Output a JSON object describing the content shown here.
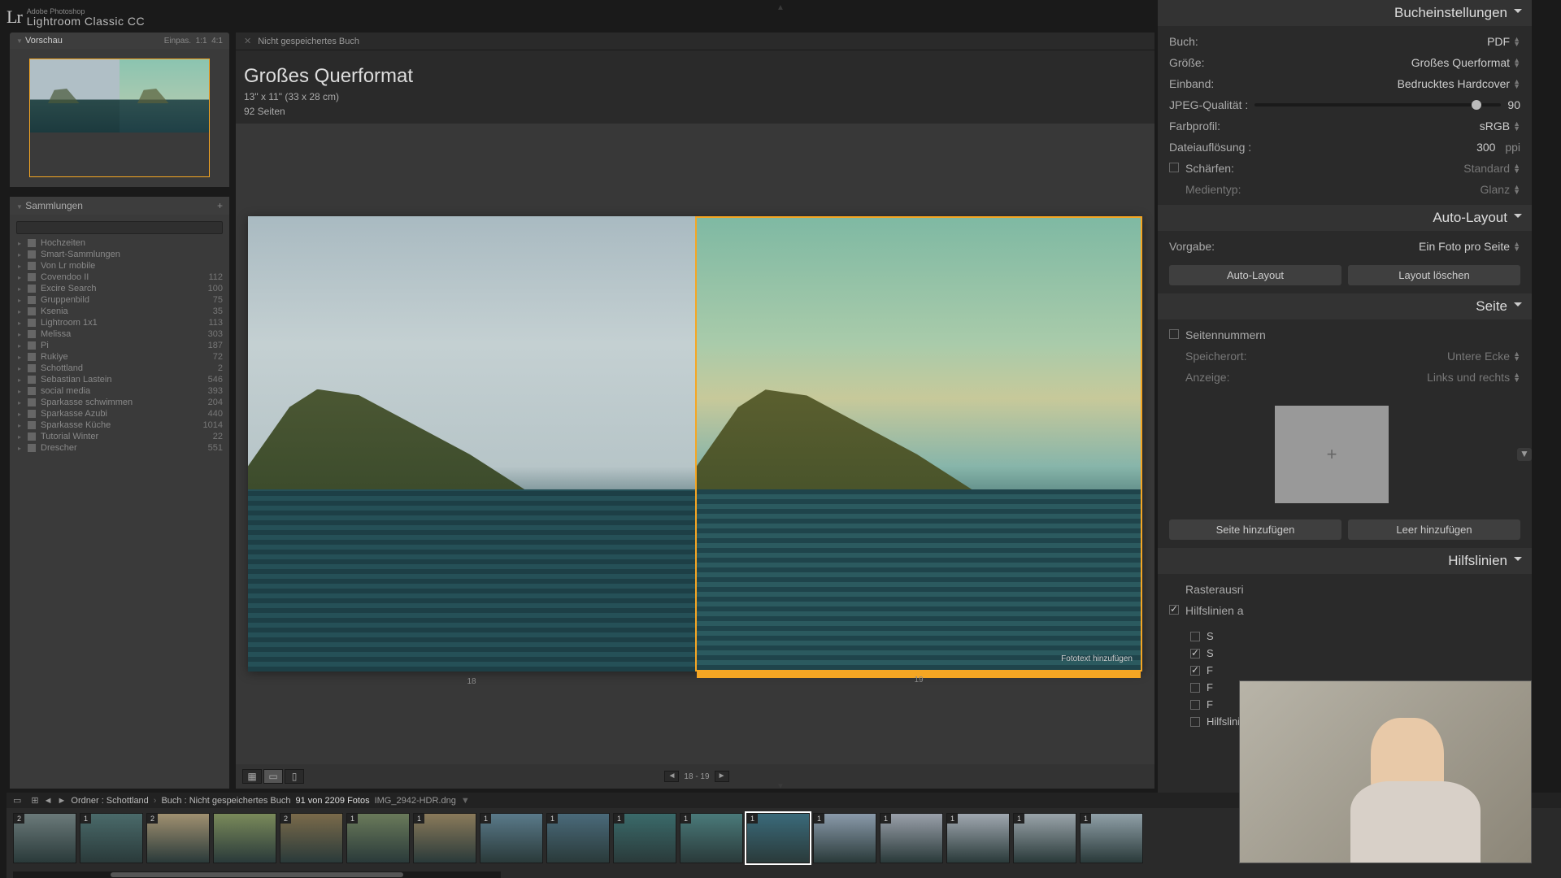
{
  "app": {
    "logo": "Lr",
    "name": "Adobe Photoshop",
    "sub": "Lightroom Classic CC"
  },
  "preview": {
    "title": "Vorschau",
    "fit": "Einpas.",
    "r1": "1:1",
    "r2": "4:1"
  },
  "collections": {
    "title": "Sammlungen",
    "items": [
      {
        "name": "Hochzeiten",
        "cnt": ""
      },
      {
        "name": "Smart-Sammlungen",
        "cnt": ""
      },
      {
        "name": "Von Lr mobile",
        "cnt": ""
      },
      {
        "name": "Covendoo II",
        "cnt": "112"
      },
      {
        "name": "Excire Search",
        "cnt": "100"
      },
      {
        "name": "Gruppenbild",
        "cnt": "75"
      },
      {
        "name": "Ksenia",
        "cnt": "35"
      },
      {
        "name": "Lightroom 1x1",
        "cnt": "113"
      },
      {
        "name": "Melissa",
        "cnt": "303"
      },
      {
        "name": "Pi",
        "cnt": "187"
      },
      {
        "name": "Rukiye",
        "cnt": "72"
      },
      {
        "name": "Schottland",
        "cnt": "2"
      },
      {
        "name": "Sebastian Lastein",
        "cnt": "546"
      },
      {
        "name": "social media",
        "cnt": "393"
      },
      {
        "name": "Sparkasse schwimmen",
        "cnt": "204"
      },
      {
        "name": "Sparkasse Azubi",
        "cnt": "440"
      },
      {
        "name": "Sparkasse Küche",
        "cnt": "1014"
      },
      {
        "name": "Tutorial Winter",
        "cnt": "22"
      },
      {
        "name": "Drescher",
        "cnt": "551"
      }
    ]
  },
  "center": {
    "tab": "Nicht gespeichertes Buch",
    "title": "Großes Querformat",
    "dim": "13\" x 11\" (33 x 28 cm)",
    "pages": "92 Seiten",
    "leftNum": "18",
    "rightNum": "19",
    "caption": "Fototext hinzufügen",
    "pager": "18  -  19"
  },
  "path": {
    "p1": "Ordner : Schottland",
    "p2": "Buch : Nicht gespeichertes Buch",
    "count": "91 von 2209 Fotos",
    "file": "IMG_2942-HDR.dng"
  },
  "filmstrip": [
    {
      "b": "2"
    },
    {
      "b": "1"
    },
    {
      "b": "2"
    },
    {
      "b": ""
    },
    {
      "b": "2"
    },
    {
      "b": "1"
    },
    {
      "b": "1"
    },
    {
      "b": "1"
    },
    {
      "b": "1"
    },
    {
      "b": "1"
    },
    {
      "b": "1"
    },
    {
      "b": "1"
    },
    {
      "b": "1"
    },
    {
      "b": "1"
    },
    {
      "b": "1"
    },
    {
      "b": "1"
    },
    {
      "b": "1"
    }
  ],
  "settings": {
    "hdr": "Bucheinstellungen",
    "book": {
      "l": "Buch:",
      "v": "PDF"
    },
    "size": {
      "l": "Größe:",
      "v": "Großes Querformat"
    },
    "cover": {
      "l": "Einband:",
      "v": "Bedrucktes Hardcover"
    },
    "jpeg": {
      "l": "JPEG-Qualität :",
      "v": "90",
      "pct": 90
    },
    "color": {
      "l": "Farbprofil:",
      "v": "sRGB"
    },
    "res": {
      "l": "Dateiauflösung :",
      "v": "300",
      "u": "ppi"
    },
    "sharp": {
      "l": "Schärfen:",
      "v": "Standard"
    },
    "media": {
      "l": "Medientyp:",
      "v": "Glanz"
    }
  },
  "auto": {
    "hdr": "Auto-Layout",
    "preset": {
      "l": "Vorgabe:",
      "v": "Ein Foto pro Seite"
    },
    "b1": "Auto-Layout",
    "b2": "Layout löschen"
  },
  "page": {
    "hdr": "Seite",
    "nums": "Seitennummern",
    "loc": {
      "l": "Speicherort:",
      "v": "Untere Ecke"
    },
    "disp": {
      "l": "Anzeige:",
      "v": "Links und rechts"
    },
    "add": "Seite hinzufügen",
    "blank": "Leer hinzufügen"
  },
  "guides": {
    "hdr": "Hilfslinien",
    "grid": "Rasterausri",
    "show": "Hilfslinien a",
    "items": [
      "S",
      "S",
      "F",
      "F",
      "F",
      "Hilfslinien"
    ]
  }
}
